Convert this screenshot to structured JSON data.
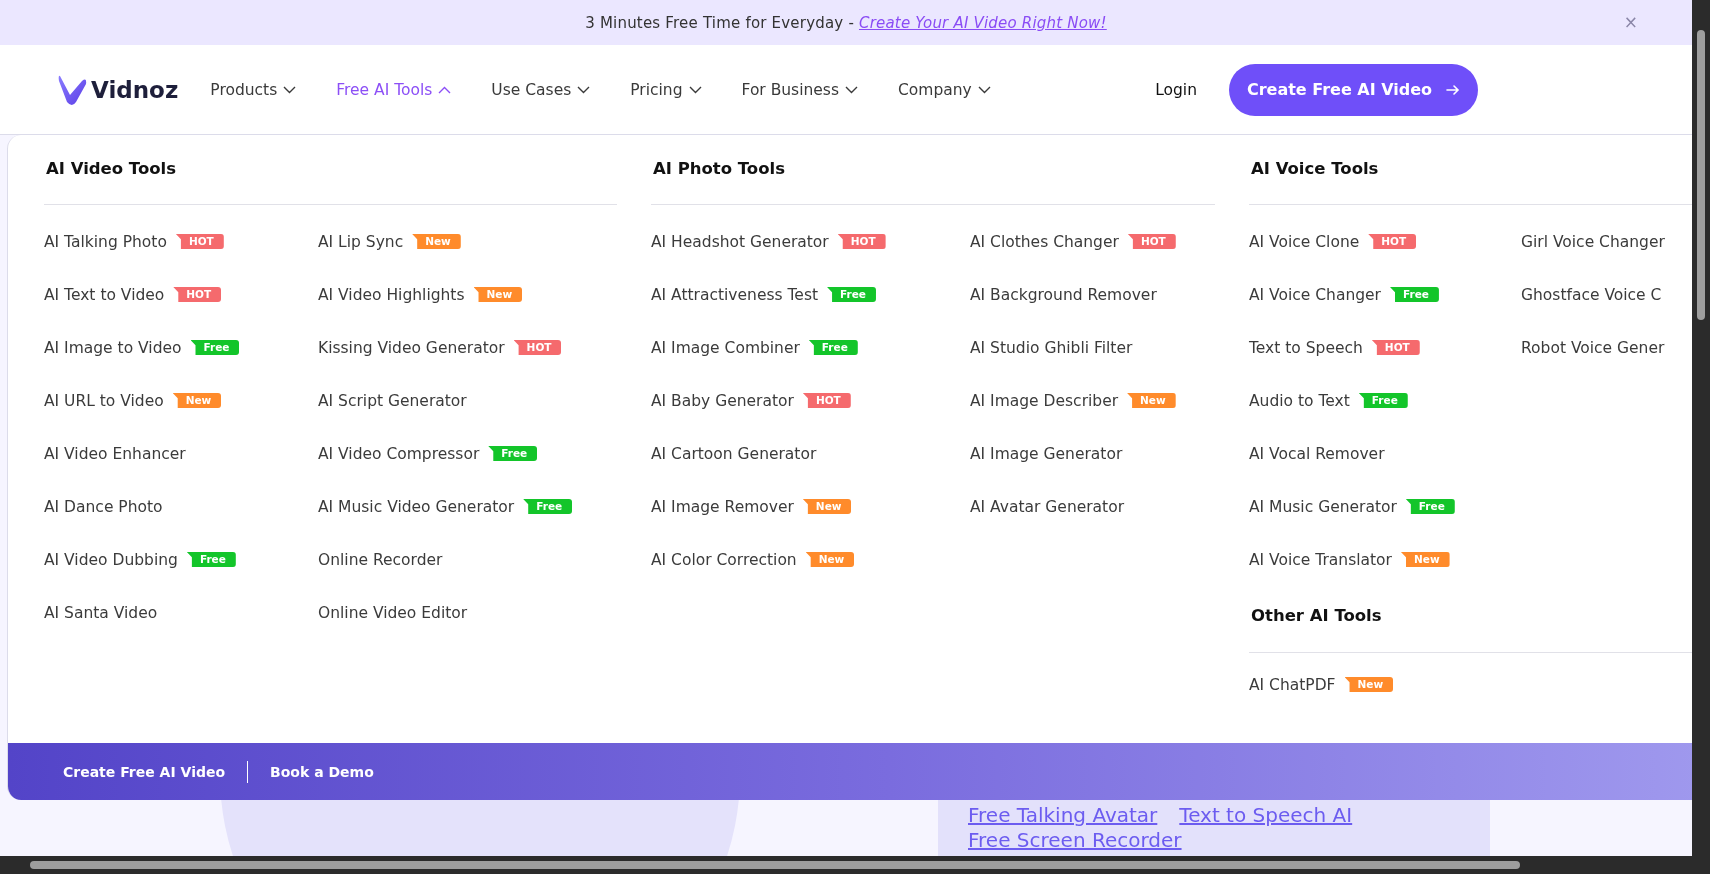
{
  "banner": {
    "text": "3 Minutes Free Time for Everyday - ",
    "link": "Create Your AI Video Right Now!",
    "close": "×"
  },
  "nav": {
    "logo": "Vidnoz",
    "items": [
      {
        "label": "Products",
        "selected": false
      },
      {
        "label": "Free AI Tools",
        "selected": true
      },
      {
        "label": "Use Cases",
        "selected": false
      },
      {
        "label": "Pricing",
        "selected": false
      },
      {
        "label": "For Business",
        "selected": false
      },
      {
        "label": "Company",
        "selected": false
      }
    ],
    "login": "Login",
    "cta": "Create Free AI Video"
  },
  "menu": {
    "sections": [
      {
        "groups": [
          {
            "title": "AI Video Tools",
            "columns": [
              [
                {
                  "label": "AI Talking Photo",
                  "badge": {
                    "kind": "hot",
                    "text": "HOT"
                  }
                },
                {
                  "label": "AI Text to Video",
                  "badge": {
                    "kind": "hot",
                    "text": "HOT"
                  }
                },
                {
                  "label": "AI Image to Video",
                  "badge": {
                    "kind": "free",
                    "text": "Free"
                  }
                },
                {
                  "label": "AI URL to Video",
                  "badge": {
                    "kind": "new",
                    "text": "New"
                  }
                },
                {
                  "label": "AI Video Enhancer"
                },
                {
                  "label": "AI Dance Photo"
                },
                {
                  "label": "AI Video Dubbing",
                  "badge": {
                    "kind": "free",
                    "text": "Free"
                  }
                },
                {
                  "label": "AI Santa Video"
                }
              ],
              [
                {
                  "label": "AI Lip Sync",
                  "badge": {
                    "kind": "new",
                    "text": "New"
                  }
                },
                {
                  "label": "AI Video Highlights",
                  "badge": {
                    "kind": "new",
                    "text": "New"
                  }
                },
                {
                  "label": "Kissing Video Generator",
                  "badge": {
                    "kind": "hot",
                    "text": "HOT"
                  }
                },
                {
                  "label": "AI Script Generator"
                },
                {
                  "label": "AI Video Compressor",
                  "badge": {
                    "kind": "free",
                    "text": "Free"
                  }
                },
                {
                  "label": "AI Music Video Generator",
                  "badge": {
                    "kind": "free",
                    "text": "Free"
                  }
                },
                {
                  "label": "Online Recorder"
                },
                {
                  "label": "Online Video Editor"
                }
              ]
            ]
          }
        ]
      },
      {
        "groups": [
          {
            "title": "AI Photo Tools",
            "columns": [
              [
                {
                  "label": "AI Headshot Generator",
                  "badge": {
                    "kind": "hot",
                    "text": "HOT"
                  }
                },
                {
                  "label": "AI Attractiveness Test",
                  "badge": {
                    "kind": "free",
                    "text": "Free"
                  }
                },
                {
                  "label": "AI Image Combiner",
                  "badge": {
                    "kind": "free",
                    "text": "Free"
                  }
                },
                {
                  "label": "AI Baby Generator",
                  "badge": {
                    "kind": "hot",
                    "text": "HOT"
                  }
                },
                {
                  "label": "AI Cartoon Generator"
                },
                {
                  "label": "AI Image Remover",
                  "badge": {
                    "kind": "new",
                    "text": "New"
                  }
                },
                {
                  "label": "AI Color Correction",
                  "badge": {
                    "kind": "new",
                    "text": "New"
                  }
                }
              ],
              [
                {
                  "label": "AI Clothes Changer",
                  "badge": {
                    "kind": "hot",
                    "text": "HOT"
                  }
                },
                {
                  "label": "AI Background Remover"
                },
                {
                  "label": "AI Studio Ghibli Filter"
                },
                {
                  "label": "AI Image Describer",
                  "badge": {
                    "kind": "new",
                    "text": "New"
                  }
                },
                {
                  "label": "AI Image Generator"
                },
                {
                  "label": "AI Avatar Generator"
                }
              ]
            ]
          }
        ]
      },
      {
        "groups": [
          {
            "title": "AI Voice Tools",
            "columns": [
              [
                {
                  "label": "AI Voice Clone",
                  "badge": {
                    "kind": "hot",
                    "text": "HOT"
                  }
                },
                {
                  "label": "AI Voice Changer",
                  "badge": {
                    "kind": "free",
                    "text": "Free"
                  }
                },
                {
                  "label": "Text to Speech",
                  "badge": {
                    "kind": "hot",
                    "text": "HOT"
                  }
                },
                {
                  "label": "Audio to Text",
                  "badge": {
                    "kind": "free",
                    "text": "Free"
                  }
                },
                {
                  "label": "AI Vocal Remover"
                },
                {
                  "label": "AI Music Generator",
                  "badge": {
                    "kind": "free",
                    "text": "Free"
                  }
                },
                {
                  "label": "AI Voice Translator",
                  "badge": {
                    "kind": "new",
                    "text": "New"
                  }
                }
              ],
              [
                {
                  "label": "Girl Voice Changer"
                },
                {
                  "label": "Ghostface Voice C"
                },
                {
                  "label": "Robot Voice Gener"
                }
              ]
            ]
          },
          {
            "title": "Other AI Tools",
            "columns": [
              [
                {
                  "label": "AI ChatPDF",
                  "badge": {
                    "kind": "new",
                    "text": "New"
                  }
                }
              ]
            ]
          }
        ]
      }
    ],
    "footer": [
      "Create Free AI Video",
      "Book a Demo"
    ]
  },
  "background_links": [
    "Free Talking Avatar",
    "Text to Speech AI",
    "Free Screen Recorder"
  ]
}
